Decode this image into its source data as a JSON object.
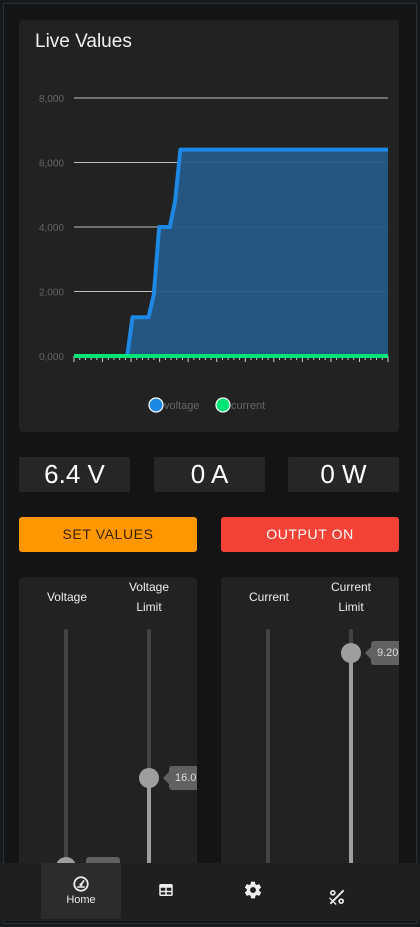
{
  "card": {
    "title": "Live Values"
  },
  "chart_data": {
    "type": "area",
    "title": "Live Values",
    "yticks": [
      "8,000",
      "6,000",
      "4,000",
      "2,000",
      "0,000"
    ],
    "ylim": [
      0,
      8
    ],
    "grid": true,
    "legend_position": "bottom",
    "series": [
      {
        "name": "voltage",
        "color": "#1e88e5",
        "fill": "#255a87",
        "values": [
          0,
          0,
          0,
          0,
          0,
          0,
          0,
          0,
          0,
          0,
          0,
          1.2,
          1.2,
          1.2,
          1.2,
          1.9,
          4.0,
          4.0,
          4.0,
          4.8,
          6.4,
          6.4,
          6.4,
          6.4,
          6.4,
          6.4,
          6.4,
          6.4,
          6.4,
          6.4,
          6.4,
          6.4,
          6.4,
          6.4,
          6.4,
          6.4,
          6.4,
          6.4,
          6.4,
          6.4,
          6.4,
          6.4,
          6.4,
          6.4,
          6.4,
          6.4,
          6.4,
          6.4,
          6.4,
          6.4,
          6.4,
          6.4,
          6.4,
          6.4,
          6.4,
          6.4,
          6.4,
          6.4,
          6.4,
          6.4
        ]
      },
      {
        "name": "current",
        "color": "#00e676",
        "fill": "none",
        "values": [
          0,
          0,
          0,
          0,
          0,
          0,
          0,
          0,
          0,
          0,
          0,
          0,
          0,
          0,
          0,
          0,
          0,
          0,
          0,
          0,
          0,
          0,
          0,
          0,
          0,
          0,
          0,
          0,
          0,
          0,
          0,
          0,
          0,
          0,
          0,
          0,
          0,
          0,
          0,
          0,
          0,
          0,
          0,
          0,
          0,
          0,
          0,
          0,
          0,
          0,
          0,
          0,
          0,
          0,
          0,
          0,
          0,
          0,
          0,
          0
        ]
      }
    ]
  },
  "readouts": {
    "voltage": "6.4 V",
    "current": "0 A",
    "power": "0 W"
  },
  "buttons": {
    "set_values": "SET VALUES",
    "output_on": "OUTPUT ON"
  },
  "sliders": {
    "voltage": {
      "label": "Voltage",
      "value": 0.0
    },
    "voltage_limit": {
      "label_line1": "Voltage",
      "label_line2": "Limit",
      "tip": "16.0",
      "value": 0.36
    },
    "current": {
      "label": "Current",
      "value": 0.0
    },
    "current_limit": {
      "label_line1": "Current",
      "label_line2": "Limit",
      "tip": "9.20",
      "value": 0.92
    }
  },
  "nav": [
    {
      "label": "Home",
      "icon": "gauge-icon",
      "active": true
    },
    {
      "label": "",
      "icon": "table-icon",
      "active": false
    },
    {
      "label": "",
      "icon": "gear-icon",
      "active": false
    },
    {
      "label": "",
      "icon": "percent-slash-icon",
      "active": false
    }
  ],
  "colors": {
    "accent": "#ff9800",
    "danger": "#f44336",
    "voltage": "#1e88e5",
    "current": "#00e676"
  }
}
